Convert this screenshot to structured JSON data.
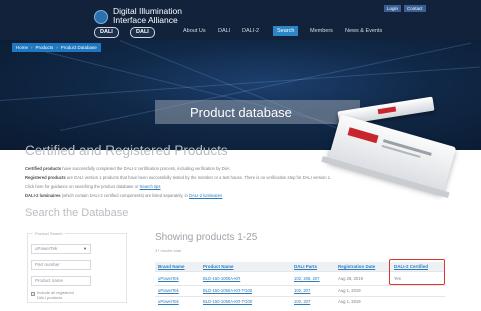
{
  "header": {
    "org_name_line1": "Digital Illumination",
    "org_name_line2": "Interface Alliance",
    "badges": [
      "DALI",
      "DALI"
    ],
    "top_links": [
      "Login",
      "Contact"
    ],
    "nav": [
      "About Us",
      "DALI",
      "DALI-2",
      "Search",
      "Members",
      "News & Events"
    ],
    "active_nav_index": 3
  },
  "breadcrumb": [
    "Home",
    "Products",
    "Product Database"
  ],
  "hero": {
    "title": "Product database"
  },
  "certified": {
    "heading": "Certified and Registered Products",
    "line1_bold": "Certified products",
    "line1_rest": " have successfully completed the DALI-2 certification process, including verification by DiiA.",
    "line2_bold": "Registered products",
    "line2_rest": " are DALI version 1 products that have been successfully tested by the member or a test house. There is no verification step for DALI version 1.",
    "line3_text": "Click here for guidance on searching the product database or ",
    "line3_link": "Search tips",
    "line4_bold": "DALI-2 luminaires",
    "line4_text": " (which contain DALI-2 certified components) are listed separately, in ",
    "line4_link": "DALI-2 luminaires"
  },
  "search": {
    "heading": "Search the Database",
    "panel_label": "Product Search",
    "brand_value": "uPowerTek",
    "part_placeholder": "Part number",
    "name_placeholder": "Product name",
    "checkbox_label_1": "Include all registered",
    "checkbox_label_2": "DALI products"
  },
  "results": {
    "title": "Showing products 1-25",
    "count_text": "37 results total",
    "columns": [
      "Brand Name",
      "Product Name",
      "DALI Parts",
      "Registration Date",
      "DALI-2 Certified"
    ],
    "rows": [
      [
        "uPowerTek",
        "BLD-150-1000A-KR",
        "102, 206, 207",
        "Aug 28, 2019",
        "Yes"
      ],
      [
        "uPowerTek",
        "BLD-150-1050A-KR-TG00",
        "102, 207",
        "Aug 1, 2019",
        ""
      ],
      [
        "uPowerTek",
        "BLD-150-1050A-KR-TG00",
        "102, 207",
        "Aug 1, 2019",
        ""
      ]
    ]
  },
  "colors": {
    "nav_bg": "#11223a",
    "accent_blue": "#2b86c8",
    "link_blue": "#2b7bbf",
    "highlight_red": "#d9382f"
  }
}
